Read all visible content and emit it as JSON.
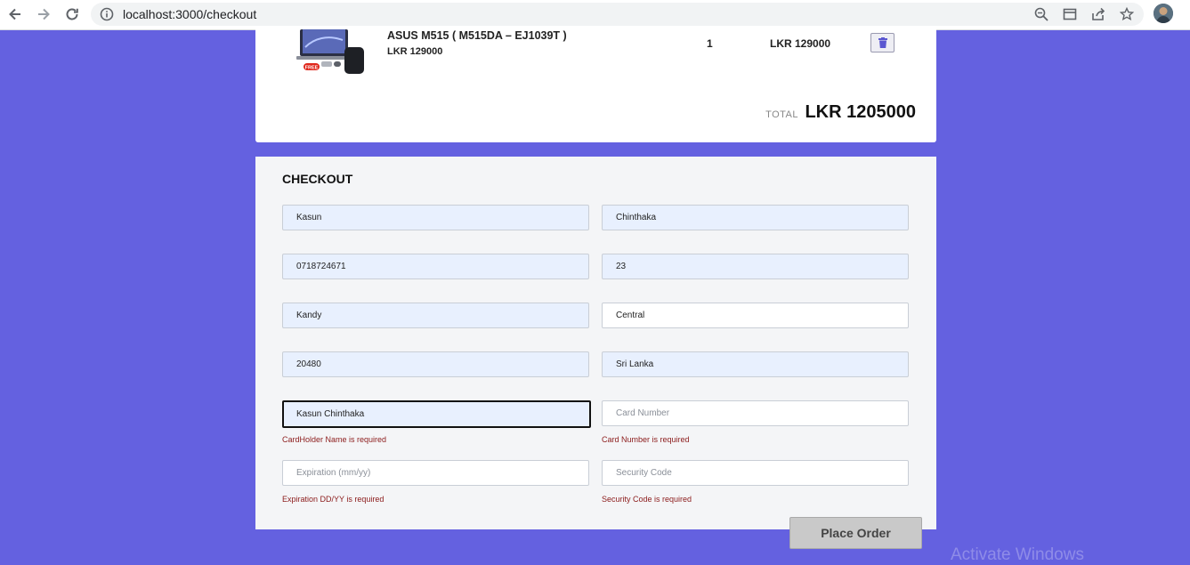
{
  "browser": {
    "url": "localhost:3000/checkout"
  },
  "cart": {
    "item": {
      "name": "ASUS M515 ( M515DA – EJ1039T )",
      "price": "LKR 129000",
      "quantity": "1",
      "line_total": "LKR 129000",
      "image_badge": "FREE"
    },
    "total_label": "TOTAL",
    "total_value": "LKR 1205000"
  },
  "checkout": {
    "title": "CHECKOUT",
    "fields": {
      "first_name": {
        "value": "Kasun"
      },
      "last_name": {
        "value": "Chinthaka"
      },
      "phone": {
        "value": "0718724671"
      },
      "address": {
        "value": "23"
      },
      "city": {
        "value": "Kandy"
      },
      "province": {
        "value": "Central"
      },
      "postal_code": {
        "value": "20480"
      },
      "country": {
        "value": "Sri Lanka"
      },
      "cardholder_name": {
        "value": "Kasun Chinthaka",
        "error": "CardHolder Name is required"
      },
      "card_number": {
        "value": "",
        "placeholder": "Card Number",
        "error": "Card Number is required"
      },
      "expiration": {
        "value": "",
        "placeholder": "Expiration (mm/yy)",
        "error": "Expiration DD/YY is required"
      },
      "security_code": {
        "value": "",
        "placeholder": "Security Code",
        "error": "Security Code is required"
      }
    },
    "place_order_label": "Place Order"
  },
  "os": {
    "watermark": "Activate Windows"
  },
  "colors": {
    "page_background": "#6461e0",
    "autofill": "#e8f0fe",
    "error_text": "#8b1a1a",
    "delete_icon": "#5b57d1"
  }
}
